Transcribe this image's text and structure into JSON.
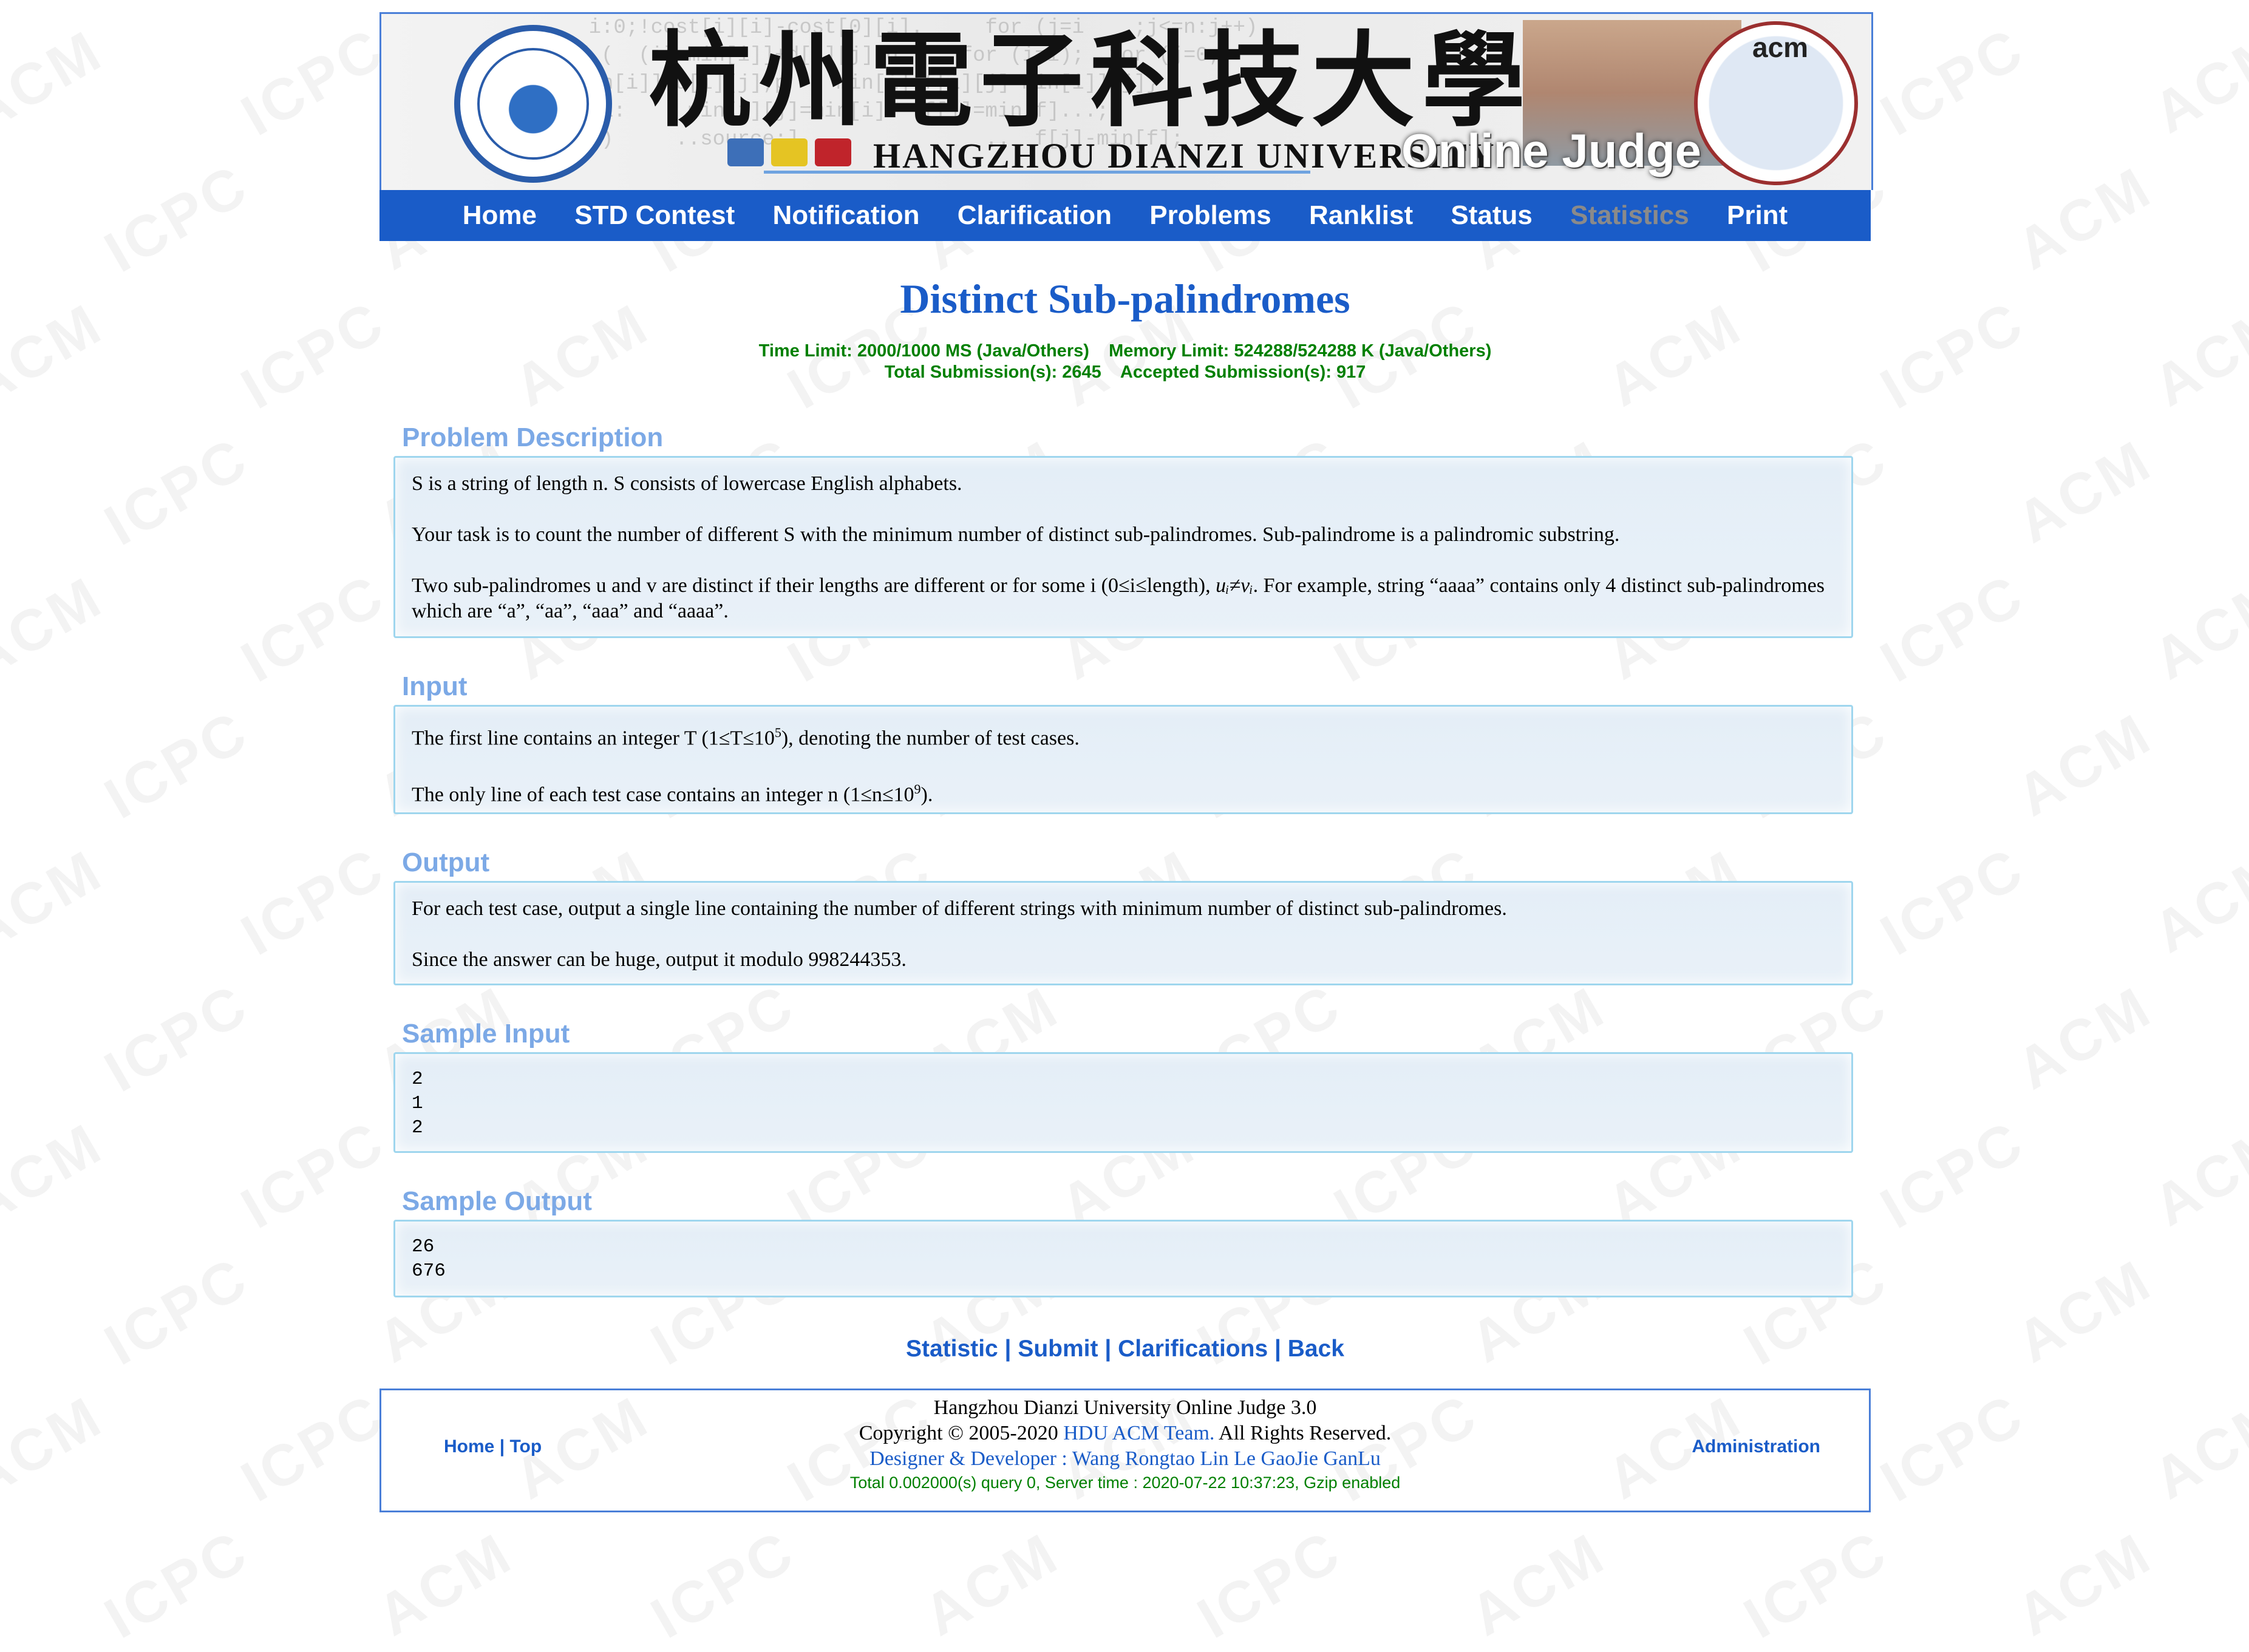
{
  "watermark": "ACM ICPC",
  "header": {
    "cn_title": "杭州電子科技大學",
    "en_title": "HANGZHOU DIANZI UNIVERSITY",
    "oj_title": "Online Judge",
    "acm_label": "acm",
    "seal_icon": "university-seal-icon",
    "acm_logo_icon": "acm-icpc-logo-icon"
  },
  "nav": {
    "items": [
      {
        "label": "Home"
      },
      {
        "label": "STD Contest"
      },
      {
        "label": "Notification"
      },
      {
        "label": "Clarification"
      },
      {
        "label": "Problems"
      },
      {
        "label": "Ranklist"
      },
      {
        "label": "Status"
      },
      {
        "label": "Statistics"
      },
      {
        "label": "Print"
      }
    ],
    "color_bg": "#1a5cc8",
    "color_dim": "#8a8a8a"
  },
  "problem": {
    "title": "Distinct Sub-palindromes",
    "limits_line1": "Time Limit: 2000/1000 MS (Java/Others)    Memory Limit: 524288/524288 K (Java/Others)",
    "limits_line2": "Total Submission(s): 2645    Accepted Submission(s): 917"
  },
  "sections": {
    "description": {
      "heading": "Problem Description",
      "p1": "S is a string of length n. S consists of lowercase English alphabets.",
      "p2": "Your task is to count the number of different S with the minimum number of distinct sub-palindromes. Sub-palindrome is a palindromic substring.",
      "p3_a": "Two sub-palindromes u and v are distinct if their lengths are different or for some i (0≤i≤length), ",
      "p3_math": "uᵢ≠vᵢ",
      "p3_b": ". For example, string “aaaa” contains only 4 distinct sub-palindromes which are “a”, “aa”, “aaa” and “aaaa”."
    },
    "input": {
      "heading": "Input",
      "l1_a": "The first line contains an integer T (1≤T≤10",
      "l1_sup": "5",
      "l1_b": "), denoting the number of test cases.",
      "l2_a": "The only line of each test case contains an integer n (1≤n≤10",
      "l2_sup": "9",
      "l2_b": ")."
    },
    "output": {
      "heading": "Output",
      "p1": "For each test case, output a single line containing the number of different strings with minimum number of distinct sub-palindromes.",
      "p2": "Since the answer can be huge, output it modulo 998244353."
    },
    "sample_input": {
      "heading": "Sample Input",
      "text": "2\n1\n2"
    },
    "sample_output": {
      "heading": "Sample Output",
      "text": "26\n676"
    }
  },
  "links": {
    "statistic": "Statistic",
    "submit": "Submit",
    "clarifications": "Clarifications",
    "back": "Back",
    "sep": " | "
  },
  "footer": {
    "home": "Home",
    "top": "Top",
    "sep": " | ",
    "line1": "Hangzhou Dianzi University Online Judge 3.0",
    "line2_a": "Copyright © 2005-2020 ",
    "line2_link": "HDU ACM Team.",
    "line2_b": " All Rights Reserved.",
    "line3": "Designer & Developer : Wang Rongtao Lin Le GaoJie GanLu",
    "line4": "Total 0.002000(s) query 0, Server time : 2020-07-22 10:37:23, Gzip enabled",
    "admin": "Administration"
  }
}
